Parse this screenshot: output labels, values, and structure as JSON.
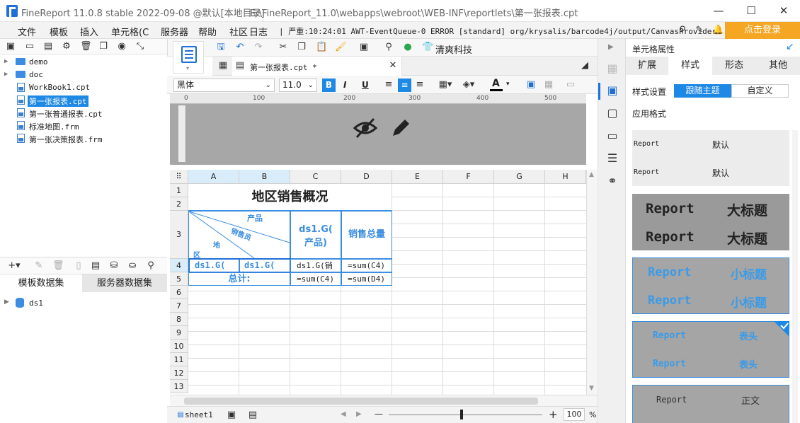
{
  "titlebar": {
    "app_title": "FineReport 11.0.8 stable 2022-09-08 @默认[本地目录]",
    "file_path": "E:\\FineReport_11.0\\webapps\\webroot\\WEB-INF\\reportlets\\第一张报表.cpt",
    "minimize": "—",
    "maximize": "☐",
    "close": "✕"
  },
  "menu": {
    "items": [
      "文件",
      "模板",
      "插入",
      "单元格(C",
      "服务器",
      "帮助",
      "社区",
      "日志"
    ],
    "log_text": "| 严重:10:24:01 AWT-EventQueue-0 ERROR [standard] org/krysalis/barcode4j/output/CanvasProvider",
    "login": "点击登录"
  },
  "tree": {
    "items": [
      {
        "label": "demo",
        "type": "folder"
      },
      {
        "label": "doc",
        "type": "folder"
      },
      {
        "label": "WorkBook1.cpt",
        "type": "file"
      },
      {
        "label": "第一张报表.cpt",
        "type": "file",
        "selected": true
      },
      {
        "label": "第一张普通报表.cpt",
        "type": "file"
      },
      {
        "label": "标准地图.frm",
        "type": "file"
      },
      {
        "label": "第一张决策报表.frm",
        "type": "file"
      }
    ]
  },
  "datasets": {
    "tab_template": "模板数据集",
    "tab_server": "服务器数据集",
    "items": [
      "ds1"
    ]
  },
  "toolbar": {
    "brand_label": "清爽科技"
  },
  "doc_tab": {
    "label": "第一张报表.cpt *"
  },
  "format": {
    "font": "黑体",
    "size": "11.0",
    "bold": "B",
    "italic": "I",
    "underline": "U"
  },
  "ruler": {
    "ticks": [
      "0",
      "100",
      "200",
      "300",
      "400",
      "500"
    ]
  },
  "sheet": {
    "columns": [
      "A",
      "B",
      "C",
      "D",
      "E",
      "F",
      "G",
      "H"
    ],
    "rows": [
      "1",
      "2",
      "3",
      "4",
      "5",
      "6",
      "7",
      "8",
      "9",
      "10",
      "11",
      "12",
      "13"
    ],
    "title": "地区销售概况",
    "diag_product": "产品",
    "diag_salesman": "销售员",
    "diag_region_a": "地",
    "diag_region_b": "区",
    "c3": "ds1.G(\n产品)",
    "c3_line1": "ds1.G(",
    "c3_line2": "产品)",
    "d3": "销售总量",
    "a4": "ds1.G(",
    "b4": "ds1.G(",
    "c4": "ds1.G(销",
    "d4": "=sum(C4)",
    "ab5": "总计:",
    "c5": "=sum(C4)",
    "d5": "=sum(D4)"
  },
  "bottom": {
    "sheet_name": "sheet1",
    "zoom": "100",
    "zoom_unit": "%",
    "minus": "—",
    "plus": "+"
  },
  "right_panel": {
    "title": "单元格属性",
    "tabs": [
      "扩展",
      "样式",
      "形态",
      "其他"
    ],
    "style_setting_label": "样式设置",
    "follow_theme": "跟随主题",
    "custom": "自定义",
    "apply_format": "应用格式",
    "cards": [
      {
        "l1": "Report",
        "r1": "默认",
        "l2": "Report",
        "r2": "默认"
      },
      {
        "l1": "Report",
        "r1": "大标题",
        "l2": "Report",
        "r2": "大标题"
      },
      {
        "l1": "Report",
        "r1": "小标题",
        "l2": "Report",
        "r2": "小标题"
      },
      {
        "l1": "Report",
        "r1": "表头",
        "l2": "Report",
        "r2": "表头"
      },
      {
        "l1": "Report",
        "r1": "正文"
      }
    ]
  }
}
